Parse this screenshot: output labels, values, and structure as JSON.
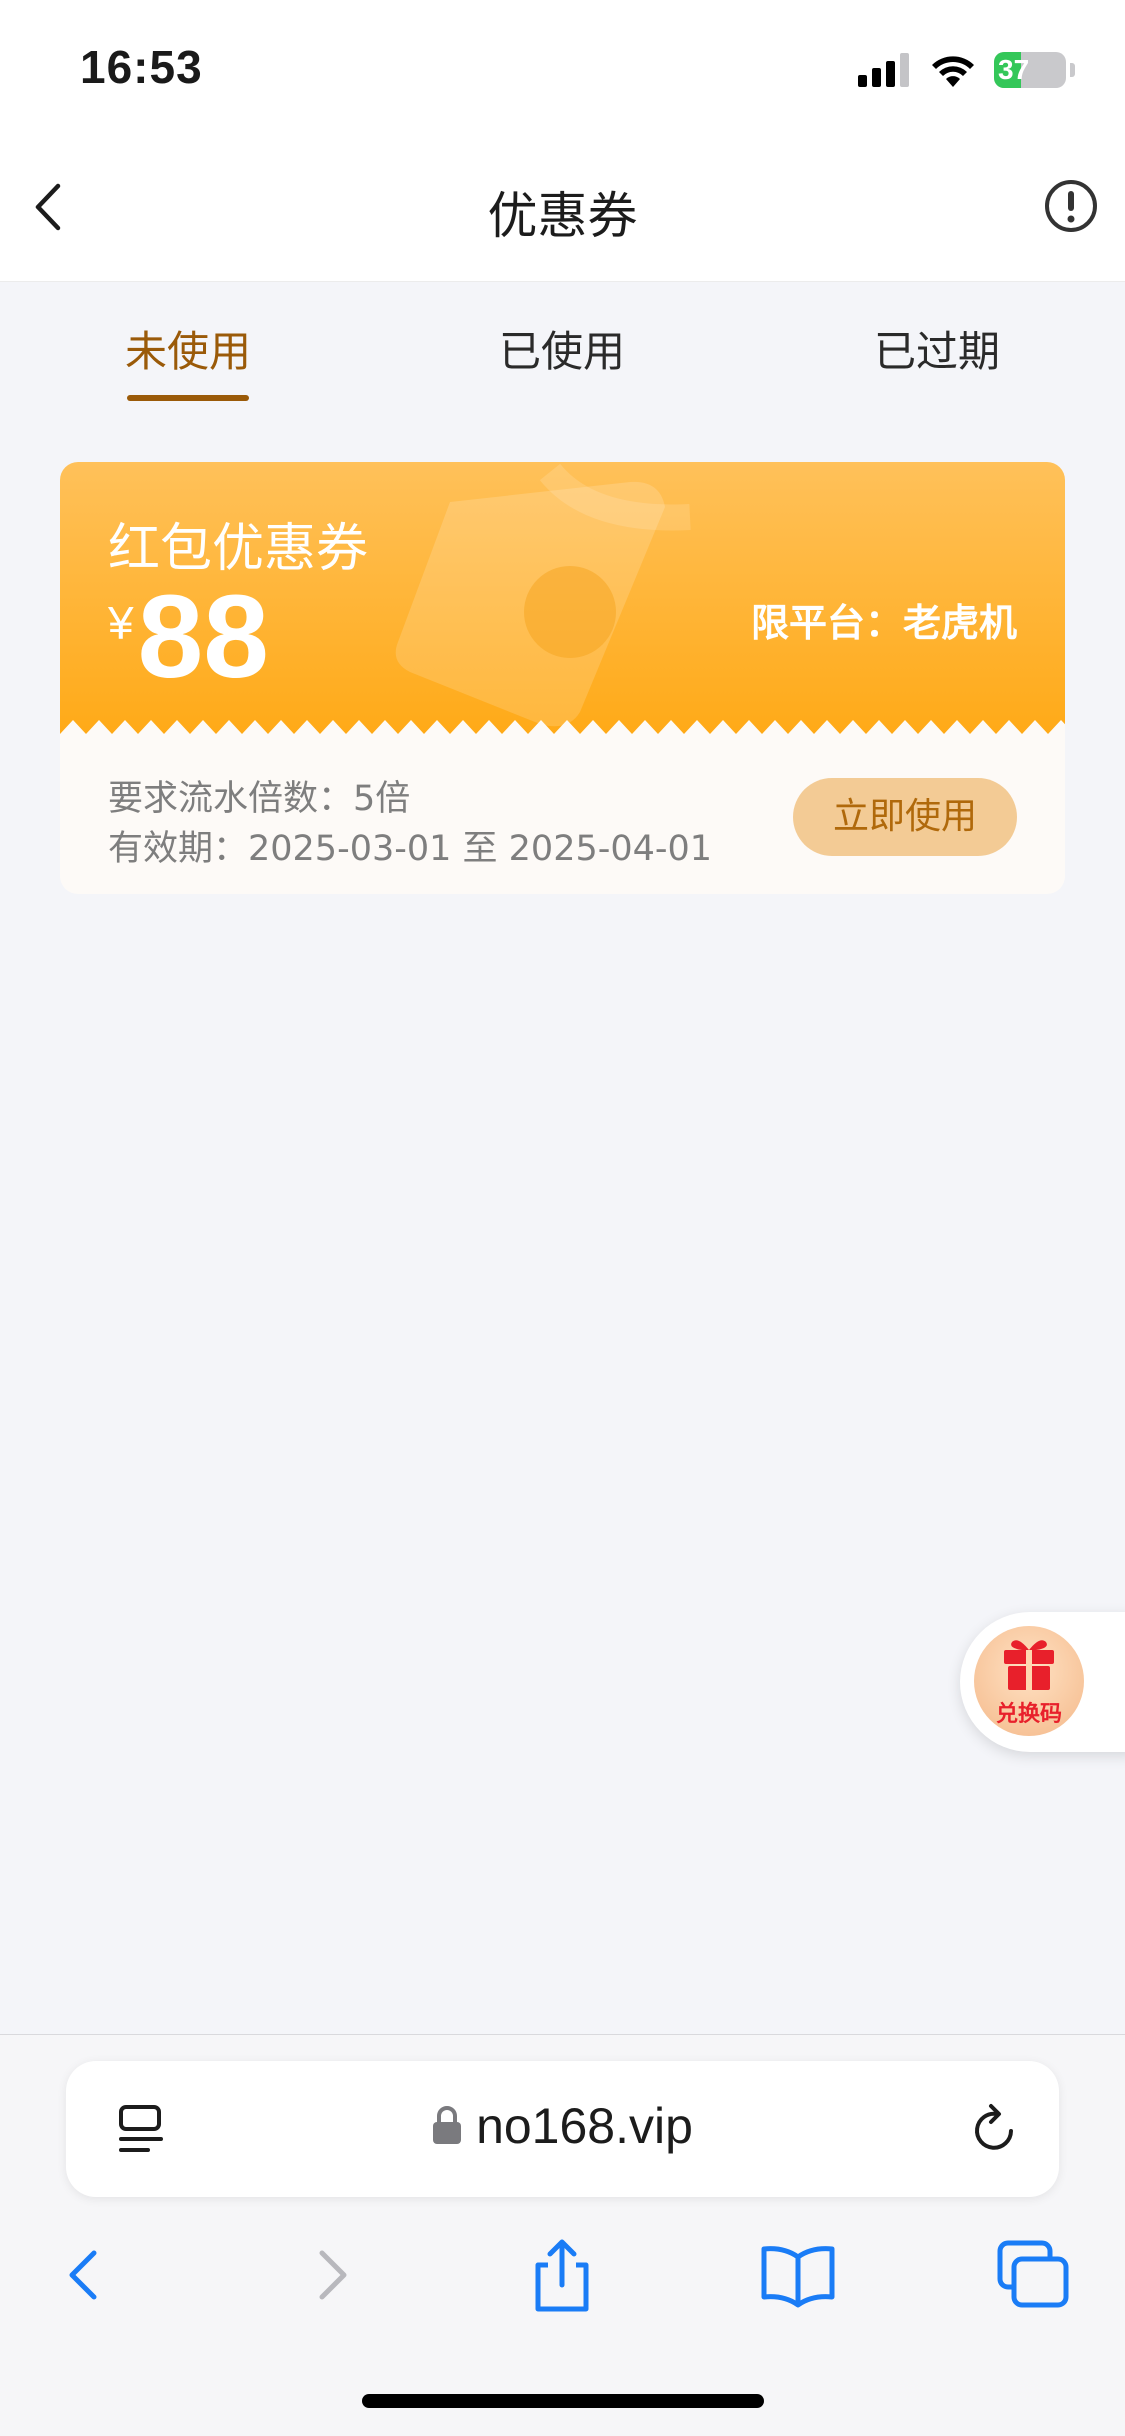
{
  "status_bar": {
    "time": "16:53",
    "battery_level": "37",
    "battery_fraction": 0.37,
    "icons": [
      "signal-icon",
      "wifi-icon",
      "battery-icon"
    ]
  },
  "nav": {
    "title": "优惠券",
    "back_icon": "chevron-left-icon",
    "info_icon": "exclamation-circle-icon"
  },
  "tabs": [
    {
      "label": "未使用",
      "active": true
    },
    {
      "label": "已使用",
      "active": false
    },
    {
      "label": "已过期",
      "active": false
    }
  ],
  "coupon": {
    "name": "红包优惠券",
    "currency": "¥",
    "amount": "88",
    "platform": "限平台：老虎机",
    "requirement": "要求流水倍数：5倍",
    "validity": "有效期：2025-03-01 至 2025-04-01",
    "use_button": "立即使用"
  },
  "redeem": {
    "label": "兑换码",
    "icon": "gift-icon"
  },
  "browser": {
    "url": "no168.vip",
    "icons": [
      "reader-icon",
      "lock-icon",
      "reload-icon",
      "back-icon",
      "forward-icon",
      "share-icon",
      "bookmarks-icon",
      "tabs-icon"
    ]
  },
  "colors": {
    "accent": "#9a5a09",
    "coupon_orange": "#ffa915",
    "button_bg": "#f3cb95",
    "redeem_red": "#e8202b",
    "safari_blue": "#1a7cf6"
  }
}
